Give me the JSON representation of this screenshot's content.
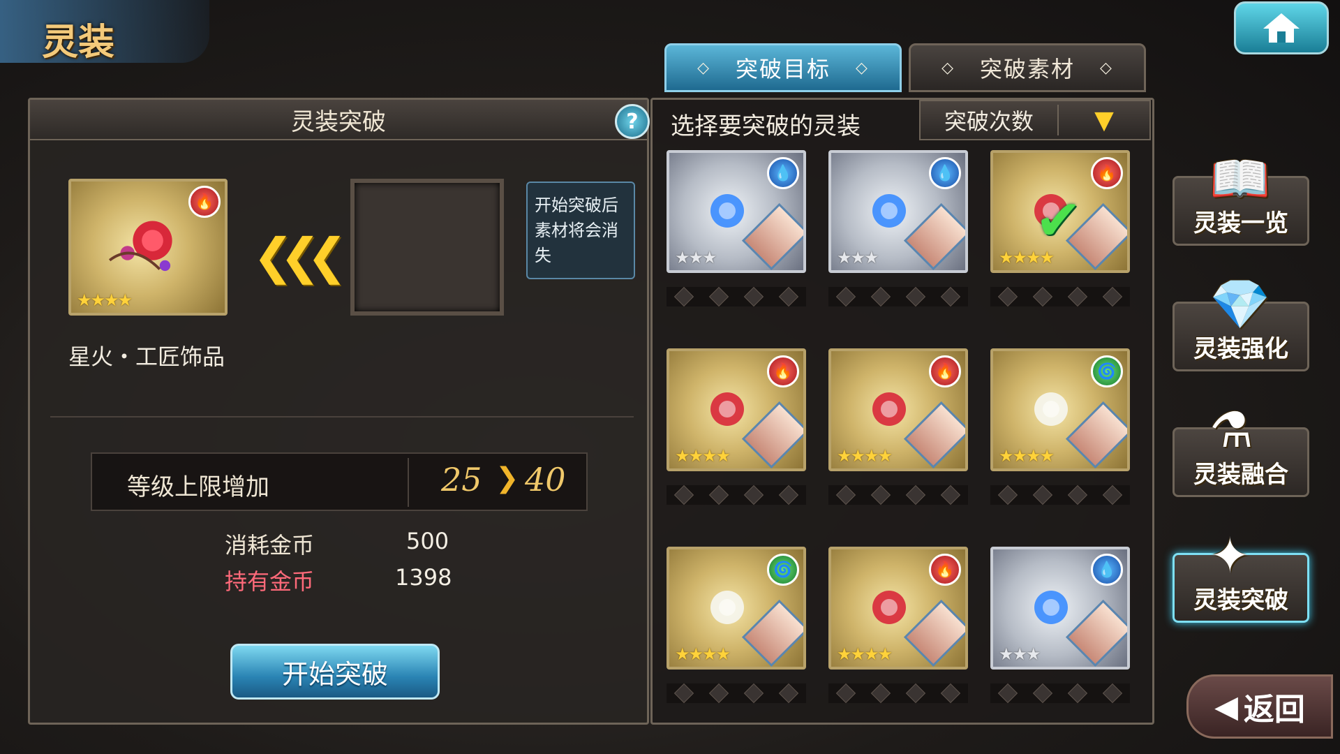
{
  "header": {
    "title": "灵装"
  },
  "tabs": [
    {
      "label": "突破目标",
      "active": true
    },
    {
      "label": "突破素材",
      "active": false
    }
  ],
  "left": {
    "title": "灵装突破",
    "help": "?",
    "selected": {
      "name": "星火・工匠饰品",
      "element": "fire",
      "stars": "★★★★"
    },
    "tooltip": "开始突破后素材将会消失",
    "level": {
      "label": "等级上限增加",
      "from": "25",
      "to": "40"
    },
    "cost_label": "消耗金币",
    "cost_value": "500",
    "gold_label": "持有金币",
    "gold_value": "1398",
    "start_button": "开始突破"
  },
  "right": {
    "title": "选择要突破的灵装",
    "sort": {
      "label": "突破次数",
      "caret": "▼"
    },
    "cards": [
      {
        "element": "water",
        "frame": "silver",
        "stars": "★★★",
        "checked": false
      },
      {
        "element": "water",
        "frame": "silver",
        "stars": "★★★",
        "checked": false
      },
      {
        "element": "fire",
        "frame": "gold",
        "stars": "★★★★",
        "checked": true
      },
      {
        "element": "fire",
        "frame": "gold",
        "stars": "★★★★",
        "checked": false
      },
      {
        "element": "fire",
        "frame": "gold",
        "stars": "★★★★",
        "checked": false
      },
      {
        "element": "wind",
        "frame": "gold",
        "stars": "★★★★",
        "checked": false
      },
      {
        "element": "wind",
        "frame": "gold",
        "stars": "★★★★",
        "checked": false
      },
      {
        "element": "fire",
        "frame": "gold",
        "stars": "★★★★",
        "checked": false
      },
      {
        "element": "water",
        "frame": "silver",
        "stars": "★★★",
        "checked": false
      }
    ]
  },
  "side_nav": [
    {
      "label": "灵装一览",
      "icon": "book-icon"
    },
    {
      "label": "灵装强化",
      "icon": "crystal-icon"
    },
    {
      "label": "灵装融合",
      "icon": "potion-icon"
    },
    {
      "label": "灵装突破",
      "icon": "gem-icon",
      "active": true
    }
  ],
  "back_button": "返回",
  "colors": {
    "accent": "#3fc6e8",
    "gold": "#ffcf2a",
    "warning": "#ff6a7a"
  }
}
